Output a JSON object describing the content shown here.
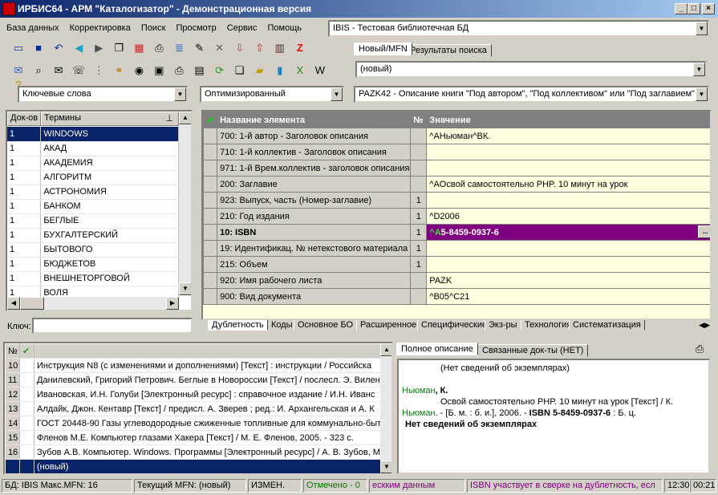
{
  "window": {
    "title": "ИРБИС64 - АРМ \"Каталогизатор\" - Демонстрационная версия",
    "min": "_",
    "max": "□",
    "close": "×"
  },
  "menu": [
    "База данных",
    "Корректировка",
    "Поиск",
    "Просмотр",
    "Сервис",
    "Помощь"
  ],
  "db_combo": "IBIS - Тестовая библиотечная БД",
  "right_tabs": [
    "Новый/MFN",
    "Результаты поиска"
  ],
  "mfn_combo": "(новый)",
  "search_combo": "Ключевые слова",
  "mode_combo": "Оптимизированный",
  "worksheet_combo": "PAZK42 - Описание книги \"Под автором\", \"Под коллективом\" или \"Под заглавием\"",
  "terms": {
    "col1": "Док-ов",
    "col2": "Термины",
    "rows": [
      [
        "1",
        "WINDOWS"
      ],
      [
        "1",
        "АКАД"
      ],
      [
        "1",
        "АКАДЕМИЯ"
      ],
      [
        "1",
        "АЛГОРИТМ"
      ],
      [
        "1",
        "АСТРОНОМИЯ"
      ],
      [
        "1",
        "БАНКОМ"
      ],
      [
        "1",
        "БЕГЛЫЕ"
      ],
      [
        "1",
        "БУХГАЛТЕРСКИЙ"
      ],
      [
        "1",
        "БЫТОВОГО"
      ],
      [
        "1",
        "БЮДЖЕТОВ"
      ],
      [
        "1",
        "ВНЕШНЕТОРГОВОЙ"
      ],
      [
        "1",
        "ВОЛЯ"
      ]
    ],
    "key_label": "Ключ:"
  },
  "fields": {
    "col_name": "Название элемента",
    "col_no": "№",
    "col_val": "Значение",
    "rows": [
      {
        "name": "700: 1-й  автор - Заголовок описания",
        "no": "",
        "val": "^AНьюман^BК."
      },
      {
        "name": "710: 1-й коллектив - Заголовок описания",
        "no": "",
        "val": ""
      },
      {
        "name": "971: 1-й Врем.коллектив - заголовок описания",
        "no": "",
        "val": ""
      },
      {
        "name": "200: Заглавие",
        "no": "",
        "val": "^AОсвой самостоятельно PHP. 10 минут на урок"
      },
      {
        "name": "923: Выпуск, часть (Номер-заглавие)",
        "no": "1",
        "val": ""
      },
      {
        "name": "210: Год издания",
        "no": "1",
        "val": "^D2006"
      },
      {
        "name": "10: ISBN",
        "no": "1",
        "val": "^A5-8459-0937-6"
      },
      {
        "name": "19: Идентификац. № нетекстового материала",
        "no": "1",
        "val": ""
      },
      {
        "name": "215: Объем",
        "no": "1",
        "val": ""
      },
      {
        "name": "920: Имя рабочего листа",
        "no": "",
        "val": "PAZK"
      },
      {
        "name": "900: Вид документа",
        "no": "",
        "val": "^B05^C21"
      }
    ],
    "ellipsis": "..."
  },
  "bottom_tabs": [
    "Дублетность",
    "Коды",
    "Основное БО",
    "Расширенное",
    "Специфические",
    "Экз-ры",
    "Технология",
    "Систематизация"
  ],
  "records": {
    "col_no": "№",
    "rows": [
      [
        "10",
        "Инструкция N8   (с изменениями и дополнениями) [Текст] : инструкции / Российска"
      ],
      [
        "11",
        "Данилевский, Григорий Петрович. Беглые в Новороссии [Текст] / послесл. Э. Вилен"
      ],
      [
        "12",
        "Ивановская, И.Н. Голуби [Электронный ресурс] : справочное издание / И.Н. Иванс"
      ],
      [
        "13",
        "Алдайк, Джон. Кентавр [Текст] / предисл. А. Зверев ; ред.: И. Архангельская и А. К"
      ],
      [
        "14",
        "ГОСТ 20448-90 Газы углеводородные сжиженные топливные для коммунально-быт"
      ],
      [
        "15",
        "Фленов М.Е. Компьютер глазами Хакера [Текст] / М. Е. Фленов, 2005. - 323 с."
      ],
      [
        "16",
        "Зубов А.В. Компьютер. Windows. Программы [Электронный ресурс] / А. В. Зубов, М"
      ],
      [
        "",
        "(новый)"
      ]
    ]
  },
  "desc_tabs": [
    "Полное описание",
    "Связанные док-ты (НЕТ)"
  ],
  "description": {
    "line1": "(Нет сведений об экземплярах)",
    "author": "Ньюман",
    "author_rest": ", К.",
    "title_line": "Освой самостоятельно PHP. 10 минут на урок [Текст] / К.",
    "author2": "Ньюман",
    "line3": ". - [Б. м. : б. и.], 2006. - ",
    "isbn": "ISBN 5-8459-0937-6",
    "line3b": " : Б. ц.",
    "line4": "Нет сведений об экземплярах"
  },
  "status": {
    "db": "БД: IBIS Макс.MFN: 16",
    "cur": "Текущий MFN: (новый)",
    "changed": "ИЗМЕН.",
    "marked": "Отмечено - 0",
    "msg1": "ескким данным",
    "msg2": "ISBN участвует в сверке на дублетность, есл",
    "time1": "12:30",
    "time2": "00:21"
  },
  "colors": {
    "selected": "#0a246a",
    "isbn_row": "#800080",
    "green": "#008000"
  }
}
